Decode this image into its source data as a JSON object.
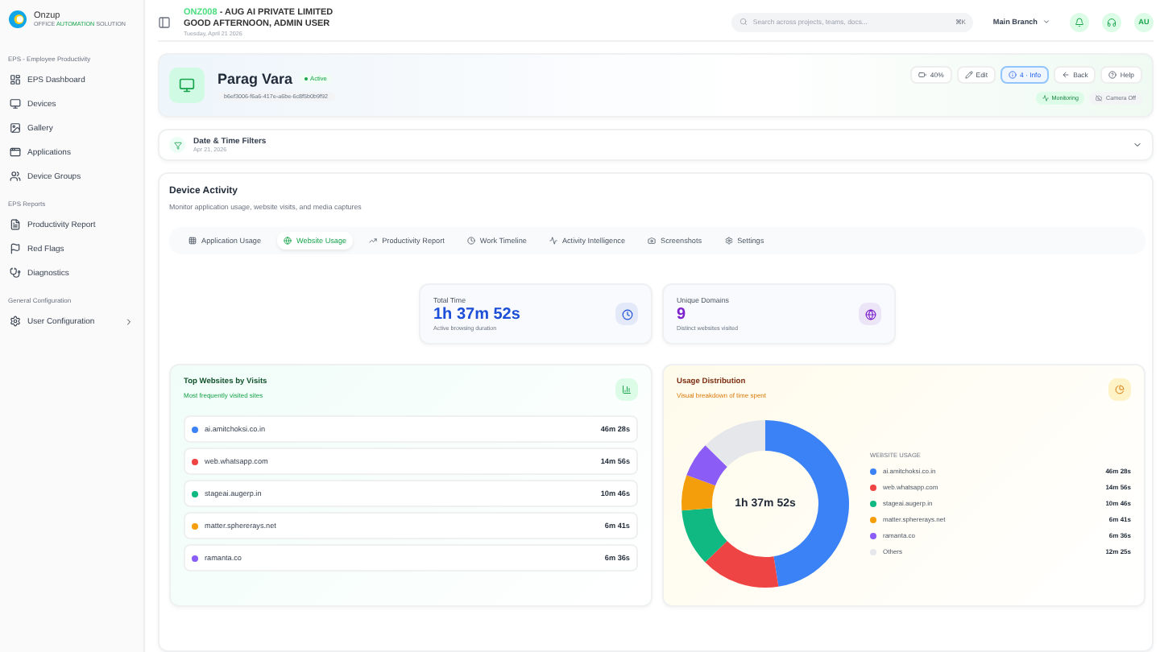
{
  "brand": {
    "name": "Onzup",
    "tagline": [
      {
        "text": "OFFICE ",
        "highlight": false
      },
      {
        "text": "AUTOMATION",
        "highlight": true
      },
      {
        "text": " SOLUTION",
        "highlight": false
      }
    ]
  },
  "sidebar": {
    "sections": [
      {
        "title": "EPS - Employee Productivity",
        "items": [
          {
            "label": "EPS Dashboard",
            "expandable": false
          },
          {
            "label": "Devices",
            "expandable": false
          },
          {
            "label": "Gallery",
            "expandable": false
          },
          {
            "label": "Applications",
            "expandable": false
          },
          {
            "label": "Device Groups",
            "expandable": false
          }
        ]
      },
      {
        "title": "EPS Reports",
        "items": [
          {
            "label": "Productivity Report",
            "expandable": false
          },
          {
            "label": "Red Flags",
            "expandable": false
          },
          {
            "label": "Diagnostics",
            "expandable": false
          }
        ]
      },
      {
        "title": "General Configuration",
        "items": [
          {
            "label": "User Configuration",
            "expandable": true
          }
        ]
      }
    ]
  },
  "header": {
    "code": "ONZ008",
    "company": " - AUG AI PRIVATE LIMITED",
    "greeting": "GOOD AFTERNOON, ADMIN USER",
    "date": "Tuesday, April 21 2026",
    "search": {
      "placeholder": "Search across projects, teams, docs...",
      "shortcut": "⌘K"
    },
    "branch": "Main Branch",
    "avatar": "AU"
  },
  "device": {
    "name": "Parag Vara",
    "status": "Active",
    "id": "b6ef3006-f6a6-417e-a6be-6c8f5b0b9f92",
    "actions": [
      {
        "label": "40%",
        "selected": false
      },
      {
        "label": "Edit",
        "selected": false
      },
      {
        "label": "4 · Info",
        "selected": true
      },
      {
        "label": "Back",
        "selected": false
      },
      {
        "label": "Help",
        "selected": false
      }
    ],
    "badges": [
      {
        "label": "Monitoring",
        "on": true
      },
      {
        "label": "Camera Off",
        "on": false
      }
    ]
  },
  "filters": {
    "title": "Date & Time Filters",
    "date": "Apr 21, 2026",
    "expanded": false
  },
  "activity": {
    "title": "Device Activity",
    "subtitle": "Monitor application usage, website visits, and media captures",
    "tabs": [
      {
        "label": "Application Usage",
        "selected": false
      },
      {
        "label": "Website Usage",
        "selected": true
      },
      {
        "label": "Productivity Report",
        "selected": false
      },
      {
        "label": "Work Timeline",
        "selected": false
      },
      {
        "label": "Activity Intelligence",
        "selected": false
      },
      {
        "label": "Screenshots",
        "selected": false
      },
      {
        "label": "Settings",
        "selected": false
      }
    ],
    "stats": [
      {
        "label": "Total Time",
        "value": "1h 37m 52s",
        "note": "Active browsing duration",
        "color": "#1d4ed8"
      },
      {
        "label": "Unique Domains",
        "value": "9",
        "note": "Distinct websites visited",
        "color": "#7e22ce"
      }
    ],
    "top_sites": {
      "title": "Top Websites by Visits",
      "subtitle": "Most frequently visited sites",
      "rows": [
        {
          "site": "ai.amitchoksi.co.in",
          "time": "46m 28s",
          "color": "#3b82f6"
        },
        {
          "site": "web.whatsapp.com",
          "time": "14m 56s",
          "color": "#ef4444"
        },
        {
          "site": "stageai.augerp.in",
          "time": "10m 46s",
          "color": "#10b981"
        },
        {
          "site": "matter.sphererays.net",
          "time": "6m 41s",
          "color": "#f59e0b"
        },
        {
          "site": "ramanta.co",
          "time": "6m 36s",
          "color": "#8b5cf6"
        }
      ]
    },
    "distribution": {
      "title": "Usage Distribution",
      "subtitle": "Visual breakdown of time spent",
      "center": "1h 37m 52s",
      "legend_title": "WEBSITE USAGE",
      "legend": [
        {
          "time": "46m 28s",
          "color": "#3b82f6"
        },
        {
          "time": "14m 56s",
          "color": "#ef4444"
        },
        {
          "time": "10m 46s",
          "color": "#10b981"
        },
        {
          "time": "6m 41s",
          "color": "#f59e0b"
        },
        {
          "time": "6m 36s",
          "color": "#8b5cf6"
        },
        {
          "time": "12m 25s",
          "color": "#e5e7eb"
        }
      ],
      "chart_data": {
        "type": "donut",
        "categories": [
          "ai.amitchoksi.co.in",
          "web.whatsapp.com",
          "stageai.augerp.in",
          "matter.sphererays.net",
          "ramanta.co",
          "Others"
        ],
        "values": [
          47.48,
          15.26,
          11.0,
          6.83,
          6.74,
          12.69
        ]
      }
    }
  }
}
